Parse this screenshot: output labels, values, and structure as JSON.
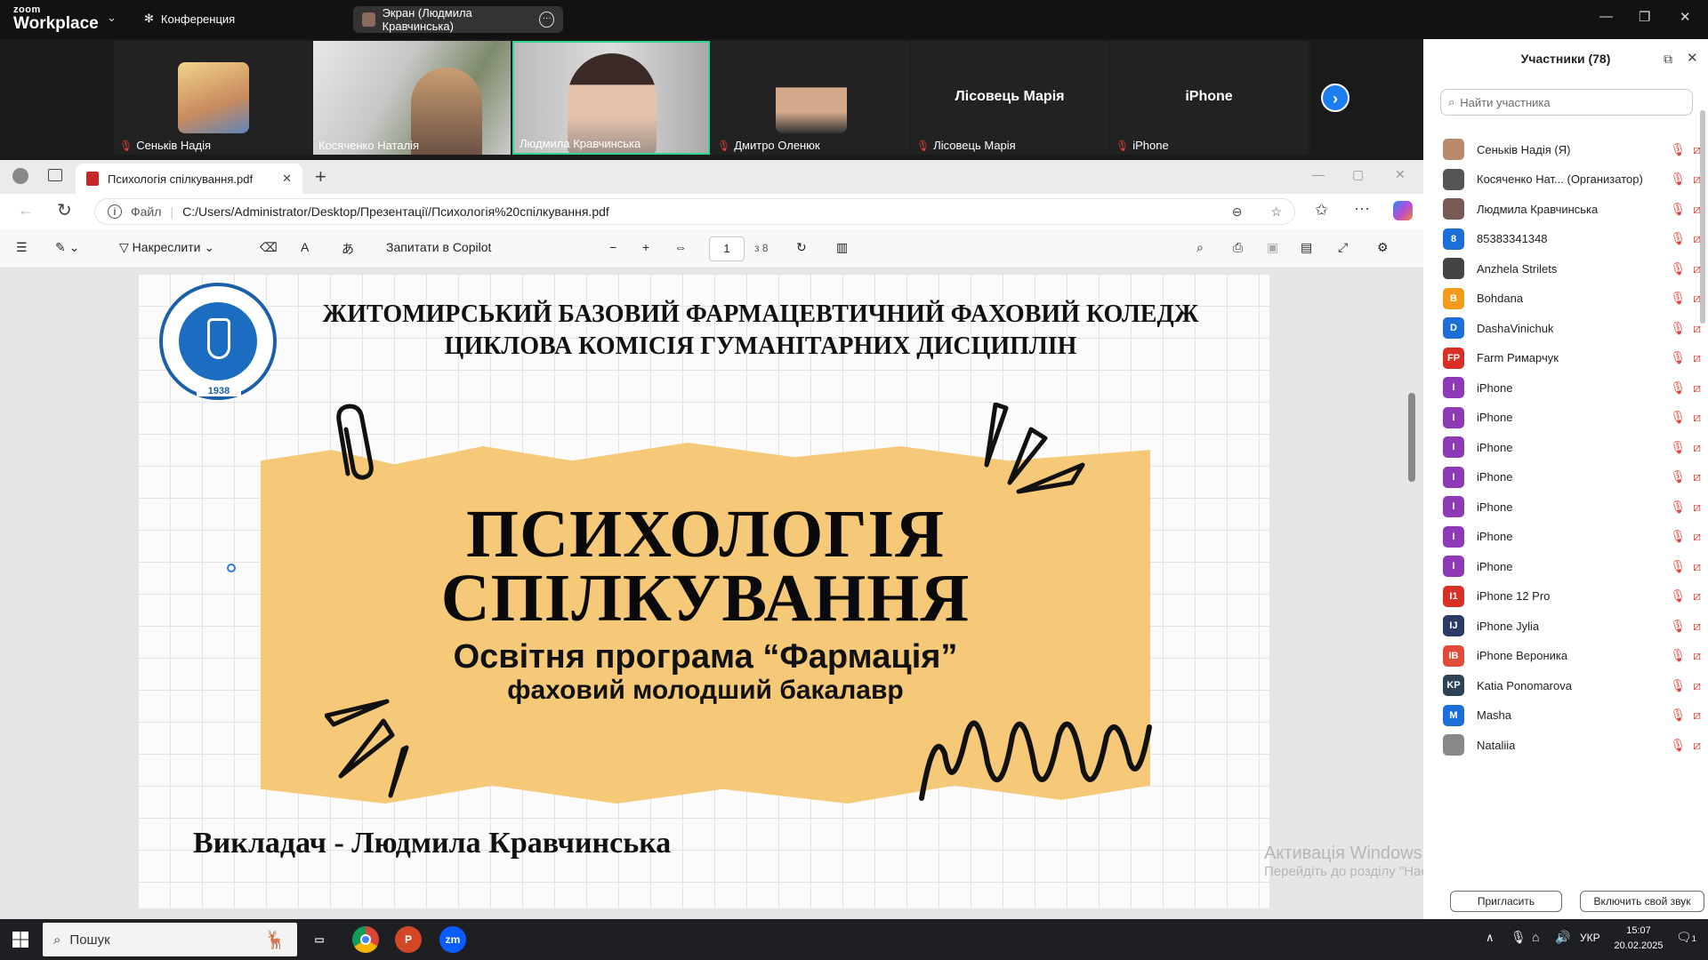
{
  "zoom": {
    "brand_small": "zoom",
    "brand_big": "Workplace",
    "meeting_label": "Конференция",
    "screen_share_label": "Экран (Людмила Кравчинська)",
    "colors": {
      "accent": "#1c7ef0",
      "active_speaker": "#2fd592",
      "muted": "#e0403a"
    }
  },
  "video_tiles": [
    {
      "name": "Сеньків Надія",
      "muted": true
    },
    {
      "name": "Косяченко Наталія",
      "muted": false
    },
    {
      "name": "Людмила Кравчинська",
      "muted": false
    },
    {
      "name": "Дмитро Оленюк",
      "muted": true
    },
    {
      "name": "Лісовець Марія",
      "muted": true,
      "big": "Лісовець Марія"
    },
    {
      "name": "iPhone",
      "muted": true,
      "big": "iPhone"
    }
  ],
  "participants": {
    "title": "Участники (78)",
    "search_placeholder": "Найти участника",
    "list": [
      {
        "name": "Сеньків Надія (Я)",
        "initials": "",
        "color": "#b98a6b"
      },
      {
        "name": "Косяченко Нат... (Организатор)",
        "initials": "",
        "color": "#555"
      },
      {
        "name": "Людмила Кравчинська",
        "initials": "",
        "color": "#7a5a55"
      },
      {
        "name": "85383341348",
        "initials": "8",
        "color": "#1c6fd6"
      },
      {
        "name": "Anzhela Strilets",
        "initials": "",
        "color": "#444"
      },
      {
        "name": "Bohdana",
        "initials": "B",
        "color": "#f49b1a"
      },
      {
        "name": "DashaVinichuk",
        "initials": "D",
        "color": "#1c6fd6"
      },
      {
        "name": "Farm Римарчук",
        "initials": "FP",
        "color": "#d93025"
      },
      {
        "name": "iPhone",
        "initials": "I",
        "color": "#8e3ab7"
      },
      {
        "name": "iPhone",
        "initials": "I",
        "color": "#8e3ab7"
      },
      {
        "name": "iPhone",
        "initials": "I",
        "color": "#8e3ab7"
      },
      {
        "name": "iPhone",
        "initials": "I",
        "color": "#8e3ab7"
      },
      {
        "name": "iPhone",
        "initials": "I",
        "color": "#8e3ab7"
      },
      {
        "name": "iPhone",
        "initials": "I",
        "color": "#8e3ab7"
      },
      {
        "name": "iPhone",
        "initials": "I",
        "color": "#8e3ab7"
      },
      {
        "name": "iPhone 12 Pro",
        "initials": "I1",
        "color": "#d93025"
      },
      {
        "name": "iPhone Jylia",
        "initials": "IJ",
        "color": "#2b3a67"
      },
      {
        "name": "iPhone Вероника",
        "initials": "IB",
        "color": "#e04b3a"
      },
      {
        "name": "Katia Ponomarova",
        "initials": "KP",
        "color": "#2d4356"
      },
      {
        "name": "Masha",
        "initials": "M",
        "color": "#1c6fd6"
      },
      {
        "name": "Nataliia",
        "initials": "",
        "color": "#888"
      }
    ],
    "invite_label": "Пригласить",
    "unmute_label": "Включить свой звук"
  },
  "edge": {
    "tab_title": "Психологія спілкування.pdf",
    "file_label": "Файл",
    "url": "C:/Users/Administrator/Desktop/Презентації/Психологія%20спілкування.pdf",
    "draw_label": "Накреслити",
    "copilot_label": "Запитати в Copilot",
    "page_current": "1",
    "page_total": "з 8"
  },
  "slide": {
    "header_line1": "ЖИТОМИРСЬКИЙ БАЗОВИЙ ФАРМАЦЕВТИЧНИЙ ФАХОВИЙ КОЛЕДЖ",
    "header_line2": "ЦИКЛОВА КОМІСІЯ ГУМАНІТАРНИХ ДИСЦИПЛІН",
    "title_line1": "ПСИХОЛОГІЯ",
    "title_line2": "СПІЛКУВАННЯ",
    "program": "Освітня програма “Фармація”",
    "degree": "фаховий молодший бакалавр",
    "teacher": "Викладач - Людмила Кравчинська",
    "logo_year": "1938",
    "paper_color": "#f5c977"
  },
  "watermark": {
    "line1": "Активація Windows",
    "line2": "Перейдіть до розділу \"Настройки\", щоб активувати Windows."
  },
  "taskbar": {
    "search_label": "Пошук",
    "lang": "УКР",
    "time": "15:07",
    "date": "20.02.2025",
    "notif_count": "1"
  }
}
